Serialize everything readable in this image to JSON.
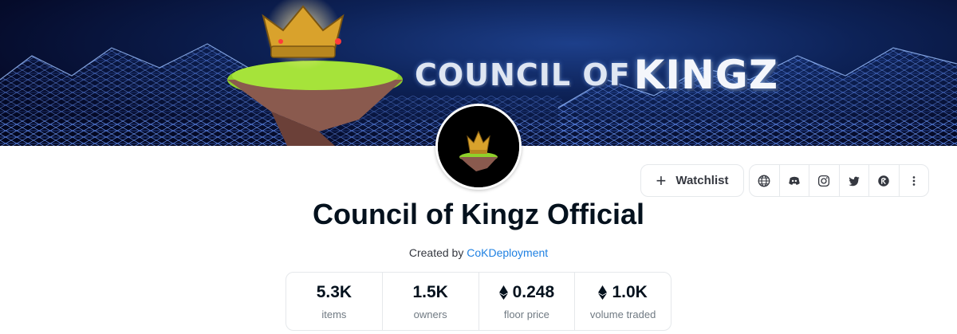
{
  "banner": {
    "title_part1": "COUNCIL OF",
    "title_part2": "KINGZ"
  },
  "collection": {
    "title": "Council of Kingz Official",
    "created_by_label": "Created by",
    "creator": "CoKDeployment"
  },
  "actions": {
    "watchlist_label": "Watchlist",
    "social_icons": [
      "globe-icon",
      "discord-icon",
      "instagram-icon",
      "twitter-icon",
      "marketplace-icon",
      "more-icon"
    ]
  },
  "stats": [
    {
      "value": "5.3K",
      "label": "items",
      "eth": false
    },
    {
      "value": "1.5K",
      "label": "owners",
      "eth": false
    },
    {
      "value": "0.248",
      "label": "floor price",
      "eth": true
    },
    {
      "value": "1.0K",
      "label": "volume traded",
      "eth": true
    }
  ],
  "colors": {
    "link": "#2081e2",
    "text": "#04111d",
    "muted": "#707a83",
    "border": "#e5e8eb"
  }
}
